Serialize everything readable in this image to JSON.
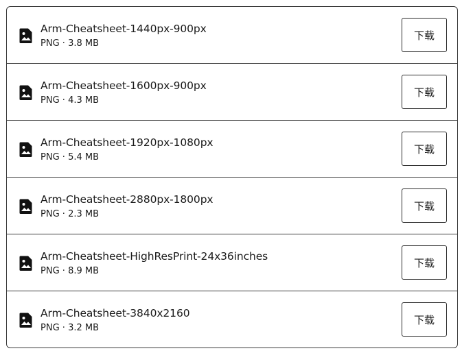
{
  "files": [
    {
      "name": "Arm-Cheatsheet-1440px-900px",
      "type": "PNG",
      "separator": "·",
      "size": "3.8 MB",
      "download_label": "下载",
      "icon": "image-file-icon"
    },
    {
      "name": "Arm-Cheatsheet-1600px-900px",
      "type": "PNG",
      "separator": "·",
      "size": "4.3 MB",
      "download_label": "下载",
      "icon": "image-file-icon"
    },
    {
      "name": "Arm-Cheatsheet-1920px-1080px",
      "type": "PNG",
      "separator": "·",
      "size": "5.4 MB",
      "download_label": "下载",
      "icon": "image-file-icon"
    },
    {
      "name": "Arm-Cheatsheet-2880px-1800px",
      "type": "PNG",
      "separator": "·",
      "size": "2.3 MB",
      "download_label": "下载",
      "icon": "image-file-icon"
    },
    {
      "name": "Arm-Cheatsheet-HighResPrint-24x36inches",
      "type": "PNG",
      "separator": "·",
      "size": "8.9 MB",
      "download_label": "下载",
      "icon": "image-file-icon"
    },
    {
      "name": "Arm-Cheatsheet-3840x2160",
      "type": "PNG",
      "separator": "·",
      "size": "3.2 MB",
      "download_label": "下载",
      "icon": "image-file-icon"
    }
  ],
  "colors": {
    "border": "#3a3a3a",
    "text": "#1a1a1a",
    "background": "#ffffff"
  }
}
